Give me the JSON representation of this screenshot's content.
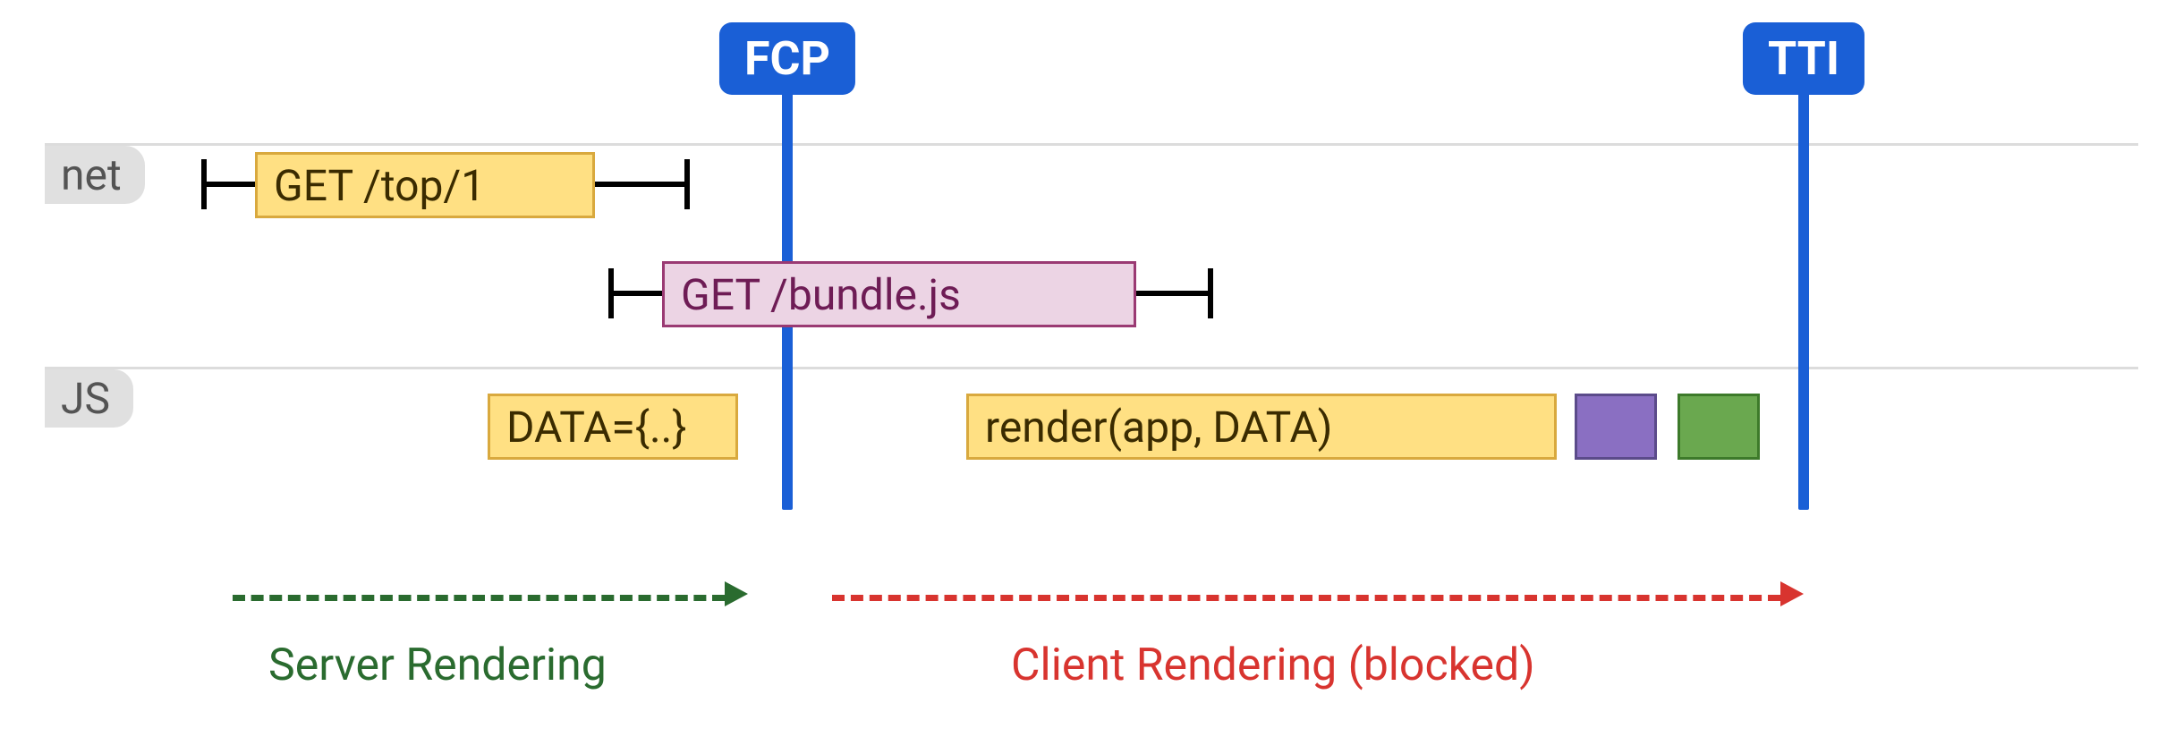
{
  "markers": {
    "fcp": {
      "label": "FCP",
      "color": "#1a5fd6"
    },
    "tti": {
      "label": "TTI",
      "color": "#1a5fd6"
    }
  },
  "lanes": {
    "net": {
      "label": "net"
    },
    "js": {
      "label": "JS"
    }
  },
  "tasks": {
    "get_top": {
      "label": "GET /top/1"
    },
    "get_bundle": {
      "label": "GET /bundle.js"
    },
    "data_blob": {
      "label": "DATA={..}"
    },
    "render": {
      "label": "render(app, DATA)"
    }
  },
  "phases": {
    "server": {
      "label": "Server Rendering",
      "color": "#2a6b2f"
    },
    "client": {
      "label": "Client Rendering (blocked)",
      "color": "#d8342f"
    }
  }
}
